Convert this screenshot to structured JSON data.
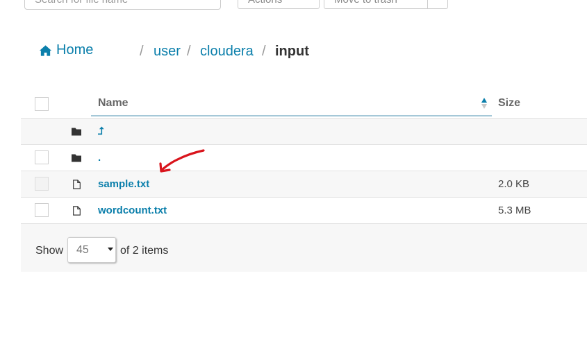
{
  "toolbar": {
    "search_placeholder": "Search for file name",
    "actions_label": "Actions",
    "trash_label": "Move to trash"
  },
  "breadcrumb": {
    "home": "Home",
    "items": [
      "user",
      "cloudera"
    ],
    "current": "input",
    "separator": "/"
  },
  "table": {
    "columns": {
      "name": "Name",
      "size": "Size"
    },
    "rows": [
      {
        "icon": "folder-icon",
        "name": "⮥",
        "size": ""
      },
      {
        "icon": "folder-icon",
        "name": ".",
        "size": ""
      },
      {
        "icon": "file-icon",
        "name": "sample.txt",
        "size": "2.0 KB"
      },
      {
        "icon": "file-icon",
        "name": "wordcount.txt",
        "size": "5.3 MB"
      }
    ]
  },
  "footer": {
    "show_label": "Show",
    "page_size": "45",
    "of_items": "of 2 items"
  },
  "colors": {
    "link": "#0b7fab",
    "annotation": "#d9141c",
    "sort_active": "#0b7fab"
  }
}
